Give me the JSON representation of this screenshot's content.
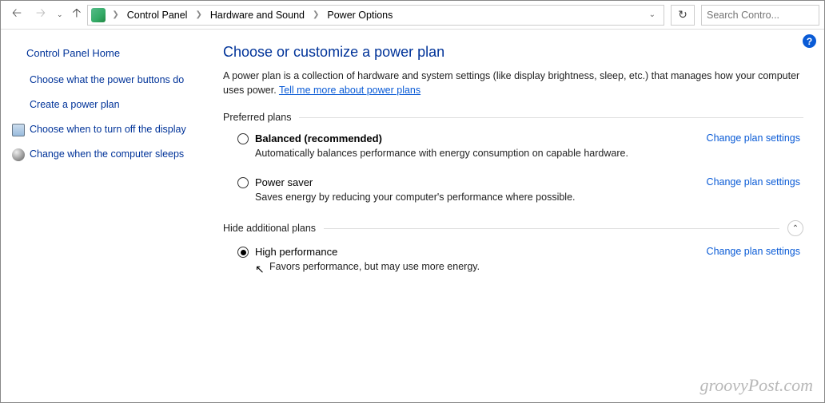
{
  "breadcrumb": {
    "items": [
      "Control Panel",
      "Hardware and Sound",
      "Power Options"
    ]
  },
  "search": {
    "placeholder": "Search Contro..."
  },
  "sidebar": {
    "home": "Control Panel Home",
    "items": [
      {
        "label": "Choose what the power buttons do"
      },
      {
        "label": "Create a power plan"
      },
      {
        "label": "Choose when to turn off the display"
      },
      {
        "label": "Change when the computer sleeps"
      }
    ]
  },
  "main": {
    "title": "Choose or customize a power plan",
    "intro_prefix": "A power plan is a collection of hardware and system settings (like display brightness, sleep, etc.) that manages how your computer uses power. ",
    "intro_link": "Tell me more about power plans",
    "section_preferred": "Preferred plans",
    "section_additional": "Hide additional plans",
    "change_link": "Change plan settings",
    "plans": {
      "balanced": {
        "label": "Balanced (recommended)",
        "desc": "Automatically balances performance with energy consumption on capable hardware."
      },
      "powersaver": {
        "label": "Power saver",
        "desc": "Saves energy by reducing your computer's performance where possible."
      },
      "highperf": {
        "label": "High performance",
        "desc": "Favors performance, but may use more energy."
      }
    }
  },
  "help_glyph": "?",
  "watermark": "groovyPost.com"
}
